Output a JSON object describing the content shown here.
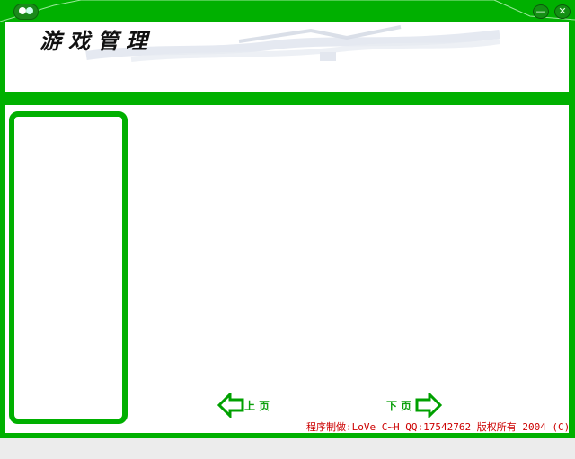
{
  "header": {
    "title": "游戏管理"
  },
  "nav": {
    "prev_label": "上页",
    "next_label": "下页"
  },
  "footer": {
    "credit": "程序制做:LoVe C~H QQ:17542762 版权所有 2004 (C)"
  },
  "window_controls": {
    "minimize_icon": "minimize-icon",
    "close_icon": "close-icon",
    "close_glyph": "✕",
    "minimize_glyph": "—"
  },
  "colors": {
    "frame": "#00b000",
    "footer_text": "#cc0000",
    "nav_arrow": "#00a000"
  }
}
